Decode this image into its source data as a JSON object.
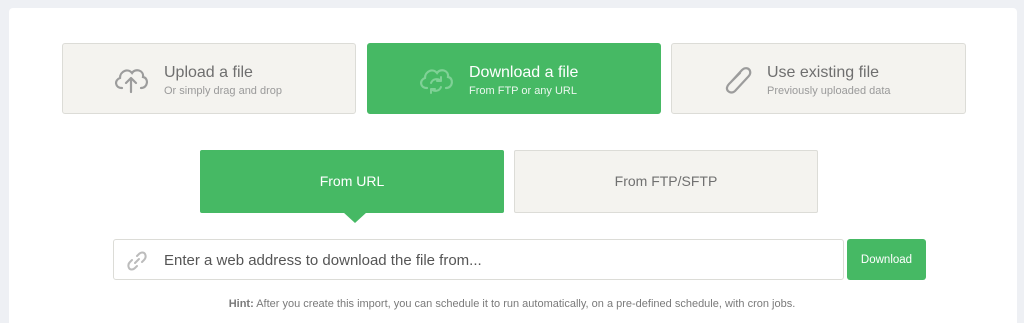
{
  "source_cards": [
    {
      "title": "Upload a file",
      "subtitle": "Or simply drag and drop",
      "icon": "cloud-upload-icon",
      "active": false
    },
    {
      "title": "Download a file",
      "subtitle": "From FTP or any URL",
      "icon": "cloud-sync-icon",
      "active": true
    },
    {
      "title": "Use existing file",
      "subtitle": "Previously uploaded data",
      "icon": "paperclip-icon",
      "active": false
    }
  ],
  "tabs": {
    "from_url": "From URL",
    "from_ftp": "From FTP/SFTP"
  },
  "url_input": {
    "placeholder": "Enter a web address to download the file from...",
    "value": "",
    "icon": "link-icon"
  },
  "download_button": "Download",
  "hint": {
    "label": "Hint:",
    "text": " After you create this import, you can schedule it to run automatically, on a pre-defined schedule, with cron jobs."
  },
  "colors": {
    "accent": "#46b964",
    "card_bg": "#f4f3ef",
    "border": "#dcdcd7",
    "page_bg": "#eef0f4"
  }
}
